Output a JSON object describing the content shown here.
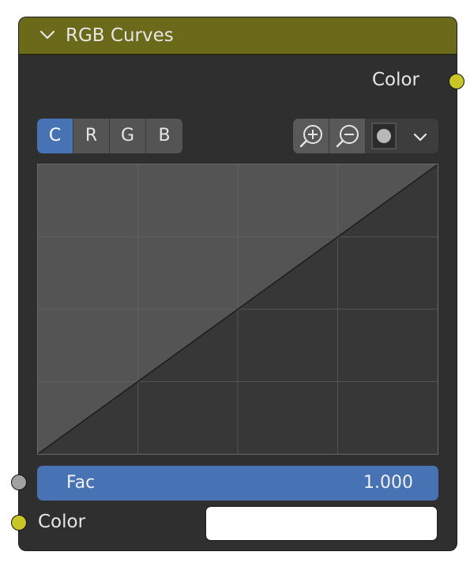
{
  "node": {
    "title": "RGB Curves",
    "header_color": "#6b6a1a",
    "body_color": "#2f2f2f"
  },
  "outputs": [
    {
      "label": "Color",
      "socket_color": "#c8c626"
    }
  ],
  "curve_tabs": [
    {
      "label": "C",
      "active": true
    },
    {
      "label": "R",
      "active": false
    },
    {
      "label": "G",
      "active": false
    },
    {
      "label": "B",
      "active": false
    }
  ],
  "curve_tools": [
    {
      "icon": "zoom-in-icon"
    },
    {
      "icon": "zoom-out-icon"
    },
    {
      "icon": "clipping-icon"
    },
    {
      "icon": "chevron-down-icon"
    }
  ],
  "inputs": {
    "fac": {
      "label": "Fac",
      "value": "1.000",
      "socket_color": "#a1a1a1"
    },
    "color": {
      "label": "Color",
      "value_color": "#ffffff",
      "socket_color": "#c8c626"
    }
  },
  "accent_color": "#4772b3"
}
